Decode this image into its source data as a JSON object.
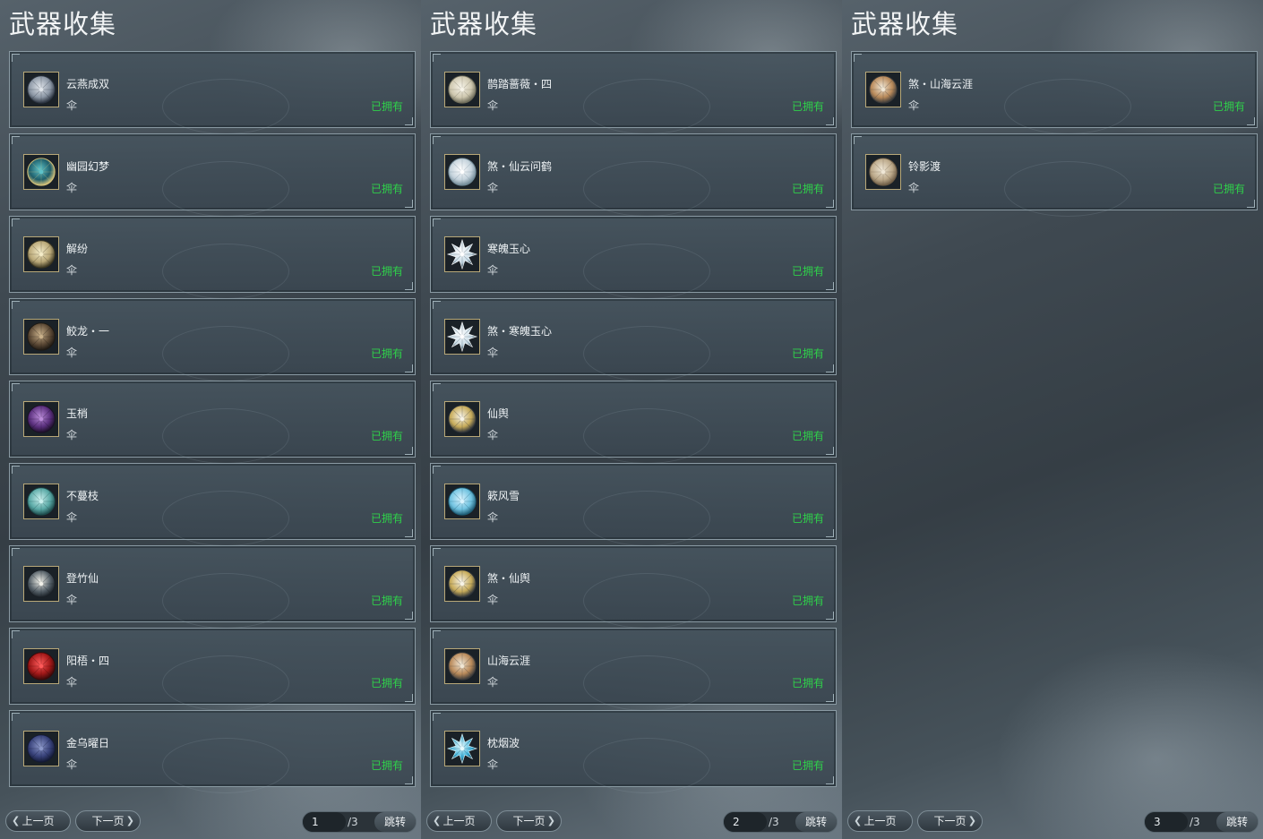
{
  "panels": [
    {
      "title": "武器收集",
      "items": [
        {
          "name": "云燕成双",
          "type": "伞",
          "status": "已拥有",
          "icon": "umbrella-silver-icon"
        },
        {
          "name": "幽园幻梦",
          "type": "伞",
          "status": "已拥有",
          "icon": "umbrella-teal-ribs-icon"
        },
        {
          "name": "解纷",
          "type": "伞",
          "status": "已拥有",
          "icon": "umbrella-cream-icon"
        },
        {
          "name": "鲛龙・一",
          "type": "伞",
          "status": "已拥有",
          "icon": "umbrella-bronze-icon"
        },
        {
          "name": "玉梢",
          "type": "伞",
          "status": "已拥有",
          "icon": "umbrella-purple-icon"
        },
        {
          "name": "不蔓枝",
          "type": "伞",
          "status": "已拥有",
          "icon": "umbrella-jade-icon"
        },
        {
          "name": "登竹仙",
          "type": "伞",
          "status": "已拥有",
          "icon": "umbrella-dark-moon-icon"
        },
        {
          "name": "阳梧・四",
          "type": "伞",
          "status": "已拥有",
          "icon": "umbrella-red-icon"
        },
        {
          "name": "金乌曜日",
          "type": "伞",
          "status": "已拥有",
          "icon": "umbrella-navy-icon"
        }
      ],
      "prev_label": "上一页",
      "next_label": "下一页",
      "page": "1",
      "total": "/3",
      "jump_label": "跳转"
    },
    {
      "title": "武器收集",
      "items": [
        {
          "name": "鹊踏蔷薇・四",
          "type": "伞",
          "status": "已拥有",
          "icon": "umbrella-pearl-icon"
        },
        {
          "name": "煞・仙云问鹤",
          "type": "伞",
          "status": "已拥有",
          "icon": "umbrella-frost-icon"
        },
        {
          "name": "寒魄玉心",
          "type": "伞",
          "status": "已拥有",
          "icon": "umbrella-crystal-star-icon"
        },
        {
          "name": "煞・寒魄玉心",
          "type": "伞",
          "status": "已拥有",
          "icon": "umbrella-crystal-star-icon"
        },
        {
          "name": "仙舆",
          "type": "伞",
          "status": "已拥有",
          "icon": "umbrella-gold-ornate-icon"
        },
        {
          "name": "簌风雪",
          "type": "伞",
          "status": "已拥有",
          "icon": "umbrella-snow-icon"
        },
        {
          "name": "煞・仙舆",
          "type": "伞",
          "status": "已拥有",
          "icon": "umbrella-gold-ornate-icon"
        },
        {
          "name": "山海云涯",
          "type": "伞",
          "status": "已拥有",
          "icon": "umbrella-landscape-icon"
        },
        {
          "name": "枕烟波",
          "type": "伞",
          "status": "已拥有",
          "icon": "umbrella-ice-burst-icon"
        }
      ],
      "prev_label": "上一页",
      "next_label": "下一页",
      "page": "2",
      "total": "/3",
      "jump_label": "跳转"
    },
    {
      "title": "武器收集",
      "items": [
        {
          "name": "煞・山海云涯",
          "type": "伞",
          "status": "已拥有",
          "icon": "umbrella-landscape-icon"
        },
        {
          "name": "铃影渡",
          "type": "伞",
          "status": "已拥有",
          "icon": "umbrella-parchment-icon"
        }
      ],
      "prev_label": "上一页",
      "next_label": "下一页",
      "page": "3",
      "total": "/3",
      "jump_label": "跳转"
    }
  ],
  "colors": {
    "owned": "#2fd04a",
    "icon_palettes": {
      "umbrella-silver-icon": [
        "#dfe4ea",
        "#8d98a6",
        "#2c3440"
      ],
      "umbrella-teal-ribs-icon": [
        "#5cc2c8",
        "#1f5e6a",
        "#d7c37a"
      ],
      "umbrella-cream-icon": [
        "#f4ecc8",
        "#b9a878",
        "#3a3520"
      ],
      "umbrella-bronze-icon": [
        "#c9b08a",
        "#5d4a36",
        "#1e1913"
      ],
      "umbrella-purple-icon": [
        "#b98ad8",
        "#5a2f7d",
        "#1c1028"
      ],
      "umbrella-jade-icon": [
        "#c9f0ee",
        "#5aa9a6",
        "#1d4a4a"
      ],
      "umbrella-dark-moon-icon": [
        "#f1f1ea",
        "#556068",
        "#1a2026"
      ],
      "umbrella-red-icon": [
        "#ff5a5a",
        "#a01818",
        "#3a0909"
      ],
      "umbrella-navy-icon": [
        "#8a96c8",
        "#38427a",
        "#141a35"
      ],
      "umbrella-pearl-icon": [
        "#f6f3e8",
        "#cfc8b0",
        "#6c6a58"
      ],
      "umbrella-frost-icon": [
        "#ffffff",
        "#c5d3dc",
        "#6f8794"
      ],
      "umbrella-crystal-star-icon": [
        "#ffffff",
        "#c7dbe6",
        "#2a3f4c"
      ],
      "umbrella-gold-ornate-icon": [
        "#f7f3e6",
        "#c7ab5a",
        "#2c3138"
      ],
      "umbrella-snow-icon": [
        "#d9f4ff",
        "#71c3e0",
        "#1d5a72"
      ],
      "umbrella-landscape-icon": [
        "#f0e6d4",
        "#b98a5a",
        "#3a3a3a"
      ],
      "umbrella-ice-burst-icon": [
        "#e8fbff",
        "#3fb4dc",
        "#0c3a4f"
      ],
      "umbrella-parchment-icon": [
        "#efe7d6",
        "#bca98a",
        "#6b5a44"
      ]
    }
  }
}
